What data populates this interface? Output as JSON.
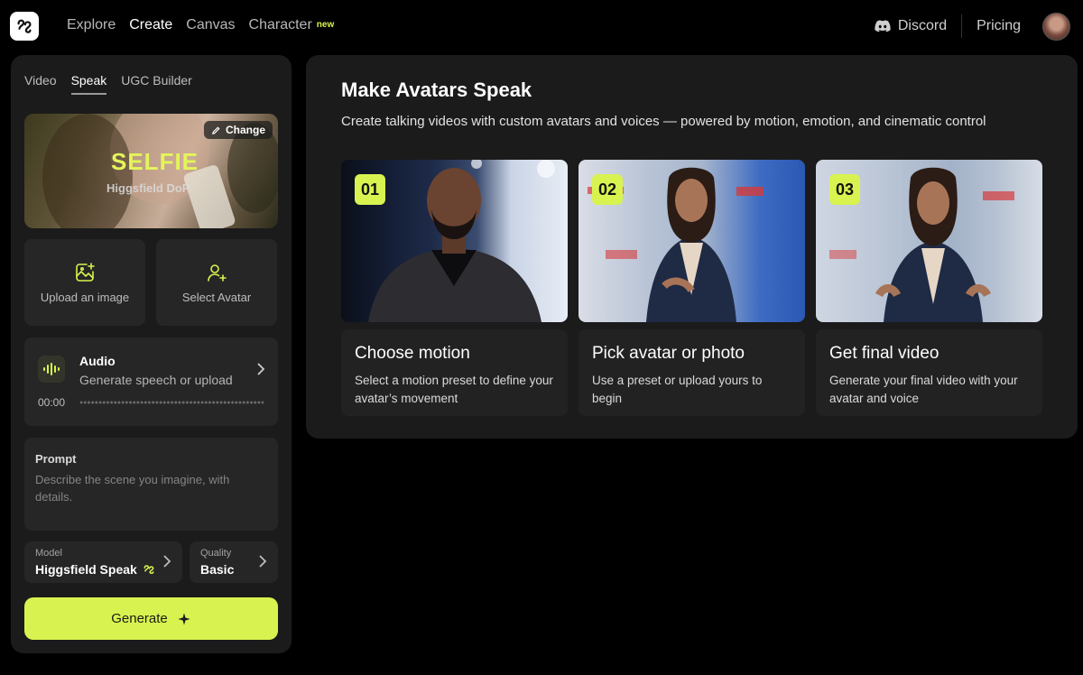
{
  "nav": {
    "links": [
      {
        "label": "Explore",
        "active": false
      },
      {
        "label": "Create",
        "active": true
      },
      {
        "label": "Canvas",
        "active": false
      },
      {
        "label": "Character",
        "active": false
      }
    ],
    "character_badge": "new",
    "discord": "Discord",
    "pricing": "Pricing"
  },
  "left": {
    "tabs": [
      {
        "label": "Video",
        "active": false
      },
      {
        "label": "Speak",
        "active": true
      },
      {
        "label": "UGC Builder",
        "active": false
      }
    ],
    "preset": {
      "title": "SELFIE",
      "subtitle": "Higgsfield DoP",
      "change_label": "Change"
    },
    "upload_image_label": "Upload an image",
    "select_avatar_label": "Select Avatar",
    "audio": {
      "title": "Audio",
      "subtitle": "Generate speech or upload",
      "time": "00:00"
    },
    "prompt": {
      "label": "Prompt",
      "placeholder": "Describe the scene you imagine, with details."
    },
    "model": {
      "label": "Model",
      "value": "Higgsfield Speak"
    },
    "quality": {
      "label": "Quality",
      "value": "Basic"
    },
    "generate_label": "Generate"
  },
  "main": {
    "title": "Make Avatars Speak",
    "subtitle": "Create talking videos with custom avatars and voices — powered by motion, emotion, and cinematic control",
    "steps": [
      {
        "num": "01",
        "title": "Choose motion",
        "desc": "Select a motion preset to define your avatar’s movement"
      },
      {
        "num": "02",
        "title": "Pick avatar or photo",
        "desc": "Use a preset or upload yours to begin"
      },
      {
        "num": "03",
        "title": "Get final video",
        "desc": "Generate your final video with your avatar and voice"
      }
    ]
  },
  "colors": {
    "accent": "#d8f34f",
    "panel": "#1b1b1b",
    "card": "#262626"
  },
  "icons": [
    "logo-icon",
    "discord-icon",
    "pencil-icon",
    "image-plus-icon",
    "user-plus-icon",
    "waveform-icon",
    "chevron-right-icon",
    "sparkle-icon"
  ]
}
